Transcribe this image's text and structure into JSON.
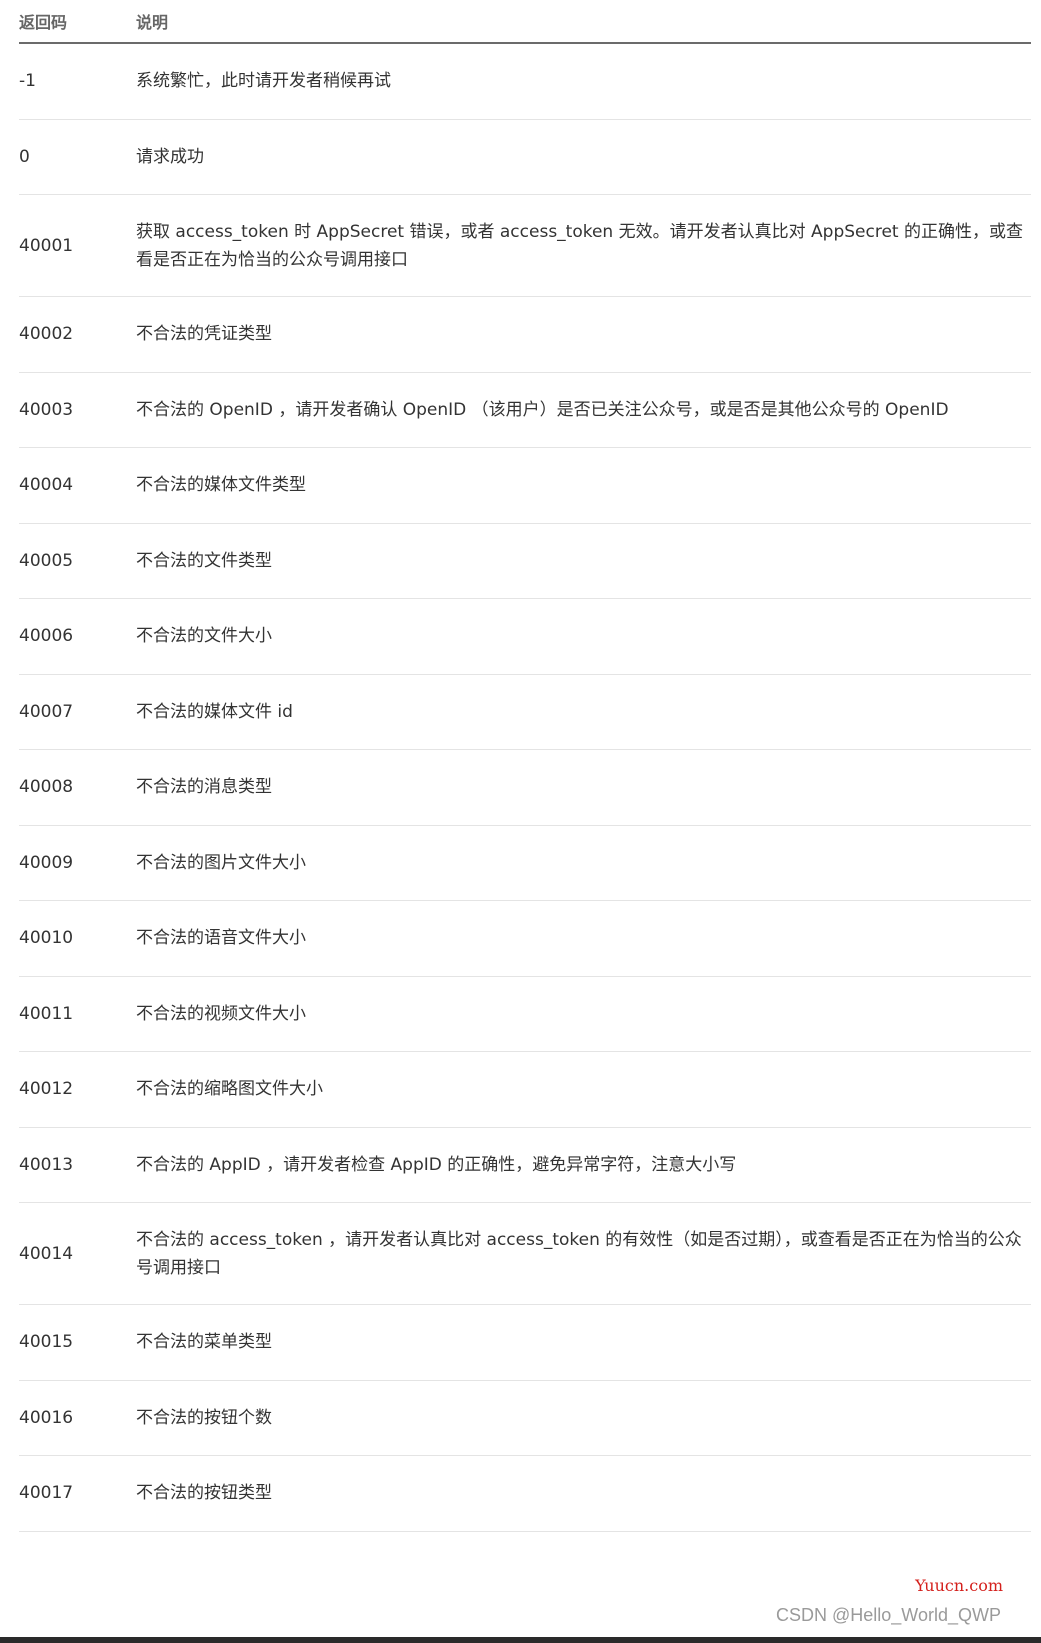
{
  "header": {
    "code": "返回码",
    "desc": "说明"
  },
  "rows": [
    {
      "code": "-1",
      "desc": "系统繁忙，此时请开发者稍候再试"
    },
    {
      "code": "0",
      "desc": "请求成功"
    },
    {
      "code": "40001",
      "desc": "获取 access_token 时 AppSecret 错误，或者 access_token 无效。请开发者认真比对 AppSecret 的正确性，或查看是否正在为恰当的公众号调用接口"
    },
    {
      "code": "40002",
      "desc": "不合法的凭证类型"
    },
    {
      "code": "40003",
      "desc": "不合法的 OpenID ，请开发者确认 OpenID （该用户）是否已关注公众号，或是否是其他公众号的 OpenID"
    },
    {
      "code": "40004",
      "desc": "不合法的媒体文件类型"
    },
    {
      "code": "40005",
      "desc": "不合法的文件类型"
    },
    {
      "code": "40006",
      "desc": "不合法的文件大小"
    },
    {
      "code": "40007",
      "desc": "不合法的媒体文件 id"
    },
    {
      "code": "40008",
      "desc": "不合法的消息类型"
    },
    {
      "code": "40009",
      "desc": "不合法的图片文件大小"
    },
    {
      "code": "40010",
      "desc": "不合法的语音文件大小"
    },
    {
      "code": "40011",
      "desc": "不合法的视频文件大小"
    },
    {
      "code": "40012",
      "desc": "不合法的缩略图文件大小"
    },
    {
      "code": "40013",
      "desc": "不合法的 AppID ，请开发者检查 AppID 的正确性，避免异常字符，注意大小写"
    },
    {
      "code": "40014",
      "desc": "不合法的 access_token ，请开发者认真比对 access_token 的有效性（如是否过期），或查看是否正在为恰当的公众号调用接口"
    },
    {
      "code": "40015",
      "desc": "不合法的菜单类型"
    },
    {
      "code": "40016",
      "desc": "不合法的按钮个数"
    },
    {
      "code": "40017",
      "desc": "不合法的按钮类型"
    }
  ],
  "watermarks": {
    "site": "Yuucn.com",
    "author": "CSDN @Hello_World_QWP"
  }
}
